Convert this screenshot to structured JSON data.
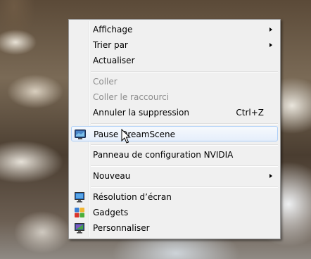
{
  "context_menu": {
    "items": [
      {
        "label": "Affichage",
        "submenu": true
      },
      {
        "label": "Trier par",
        "submenu": true
      },
      {
        "label": "Actualiser"
      },
      {
        "label": "Coller",
        "disabled": true
      },
      {
        "label": "Coller le raccourci",
        "disabled": true
      },
      {
        "label": "Annuler la suppression",
        "shortcut": "Ctrl+Z"
      },
      {
        "label": "Pause DreamScene",
        "icon": "dreamscene-icon",
        "highlighted": true
      },
      {
        "label": "Panneau de configuration NVIDIA"
      },
      {
        "label": "Nouveau",
        "submenu": true
      },
      {
        "label": "Résolution d’écran",
        "icon": "display-resolution-icon"
      },
      {
        "label": "Gadgets",
        "icon": "gadgets-icon"
      },
      {
        "label": "Personnaliser",
        "icon": "personalize-icon"
      }
    ]
  },
  "colors": {
    "menu_background": "#f0f0f0",
    "highlight_border": "#aecff7",
    "disabled_text": "#8d8d8d"
  }
}
